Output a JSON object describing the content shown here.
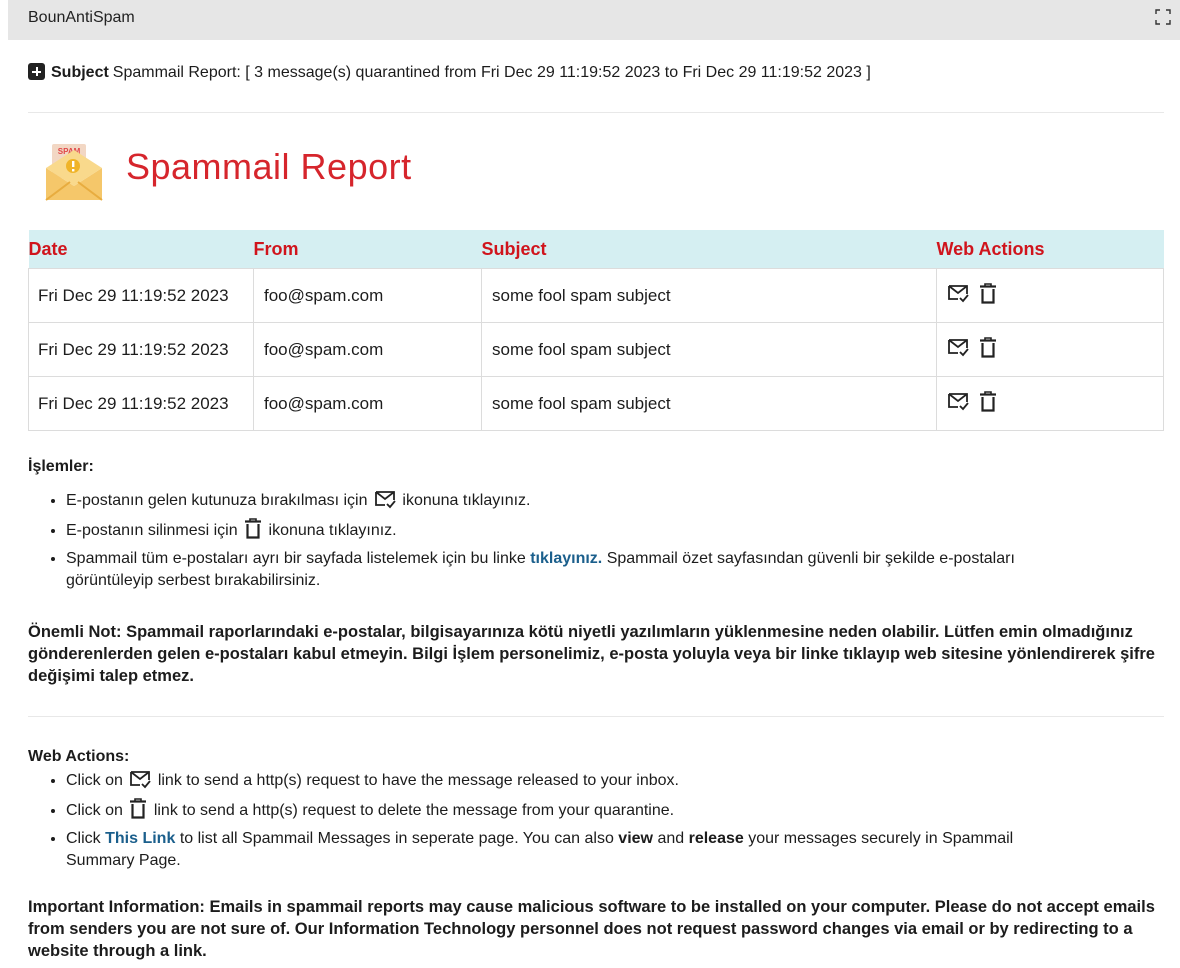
{
  "window": {
    "title": "BounAntiSpam"
  },
  "subject": {
    "label": "Subject",
    "text": "Spammail Report: [ 3 message(s) quarantined from Fri Dec 29 11:19:52 2023 to Fri Dec 29 11:19:52 2023 ]"
  },
  "report": {
    "icon_text": "SPAM",
    "title": "Spammail Report"
  },
  "table": {
    "headers": {
      "date": "Date",
      "from": "From",
      "subject": "Subject",
      "actions": "Web Actions"
    },
    "rows": [
      {
        "date": "Fri Dec 29 11:19:52 2023",
        "from": "foo@spam.com",
        "subject": "some fool spam subject"
      },
      {
        "date": "Fri Dec 29 11:19:52 2023",
        "from": "foo@spam.com",
        "subject": "some fool spam subject"
      },
      {
        "date": "Fri Dec 29 11:19:52 2023",
        "from": "foo@spam.com",
        "subject": "some fool spam subject"
      }
    ]
  },
  "tr": {
    "heading": "İşlemler:",
    "item1_pre": "E-postanın gelen kutunuza bırakılması için",
    "item1_post": "ikonuna tıklayınız.",
    "item2_pre": "E-postanın silinmesi için",
    "item2_post": "ikonuna tıklayınız.",
    "item3_pre": "Spammail tüm e-postaları ayrı bir sayfada listelemek için bu linke",
    "item3_link": "tıklayınız.",
    "item3_post": "Spammail özet sayfasından güvenli bir şekilde e-postaları görüntüleyip serbest bırakabilirsiniz.",
    "note": "Önemli Not: Spammail raporlarındaki e-postalar, bilgisayarınıza kötü niyetli yazılımların yüklenmesine neden olabilir. Lütfen emin olmadığınız gönderenlerden gelen e-postaları kabul etmeyin. Bilgi İşlem personelimiz, e-posta yoluyla veya bir linke tıklayıp web sitesine yönlendirerek şifre değişimi talep etmez."
  },
  "en": {
    "heading": "Web Actions:",
    "item1_pre": "Click on",
    "item1_post": "link to send a http(s) request to have the message released to your inbox.",
    "item2_pre": "Click on",
    "item2_post": "link to send a http(s) request to delete the message from your quarantine.",
    "item3_pre": "Click",
    "item3_link": "This Link",
    "item3_mid": "to list all Spammail Messages in seperate page. You can also",
    "item3_view": "view",
    "item3_and": "and",
    "item3_release": "release",
    "item3_post": "your messages securely in Spammail Summary Page.",
    "note": "Important Information: Emails in spammail reports may cause malicious software to be installed on your computer. Please do not accept emails from senders you are not sure of. Our Information Technology personnel does not request password changes via email or by redirecting to a website through a link."
  },
  "colors": {
    "title_red": "#d6252c",
    "header_bg": "#d5eff2",
    "link_blue": "#1b5f8c"
  }
}
